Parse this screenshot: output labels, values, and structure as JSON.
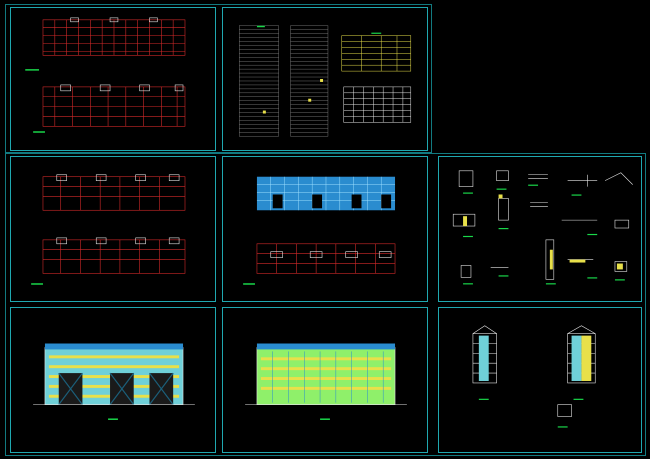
{
  "drawing_set": {
    "sheets": [
      {
        "id": "sheet-floor-plans-a",
        "kind": "floor plans"
      },
      {
        "id": "sheet-tables",
        "kind": "schedules and tables"
      },
      {
        "id": "sheet-floor-plans-b",
        "kind": "floor plans"
      },
      {
        "id": "sheet-roof-plans",
        "kind": "roof plans"
      },
      {
        "id": "sheet-details",
        "kind": "construction details"
      },
      {
        "id": "sheet-front-elevation",
        "kind": "elevation"
      },
      {
        "id": "sheet-rear-elevation",
        "kind": "elevation"
      },
      {
        "id": "sheet-sections",
        "kind": "sections"
      }
    ]
  },
  "colors": {
    "background": "#000000",
    "frame": "#1fa8b0",
    "plan_lines": "#d22a2a",
    "title_marker": "#19d84a",
    "table_lines": "#e8e04a",
    "facade_fill": "#6fd0d8",
    "roof_fill": "#2a8ccf",
    "white_lines": "#e6e6e6"
  }
}
